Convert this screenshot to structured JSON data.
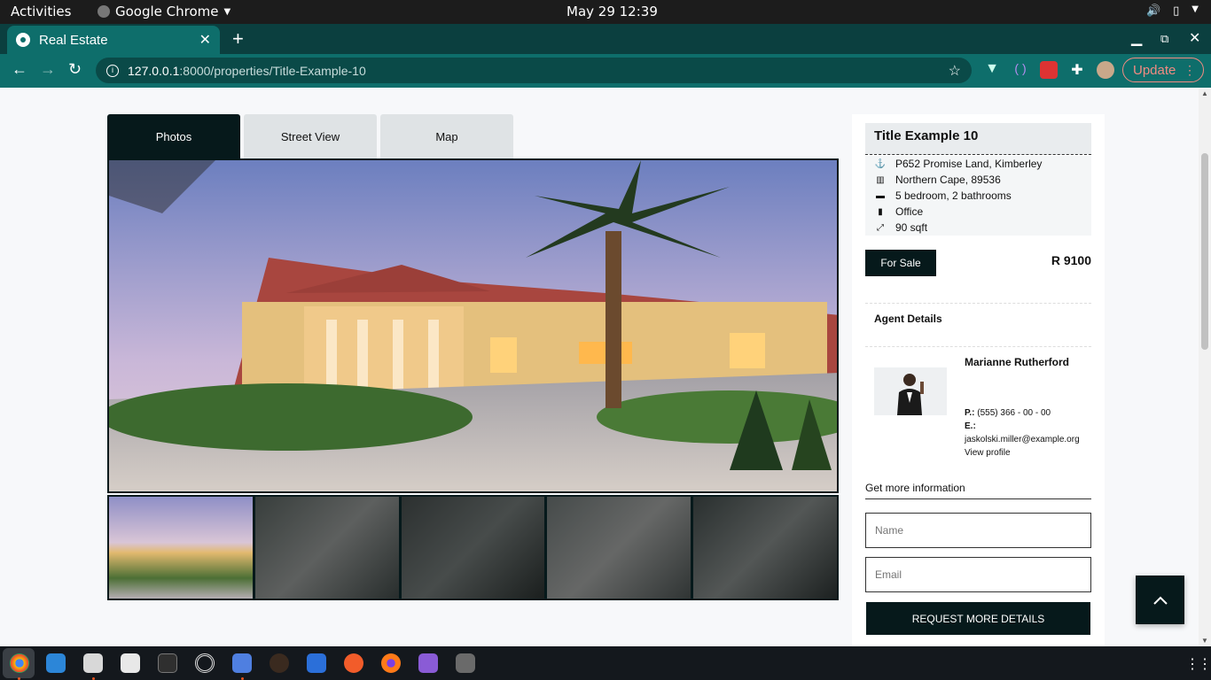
{
  "os": {
    "activities": "Activities",
    "app_name": "Google Chrome",
    "clock": "May 29  12:39"
  },
  "browser": {
    "tab_title": "Real Estate",
    "url_host": "127.0.0.1",
    "url_path": ":8000/properties/Title-Example-10",
    "update_label": "Update"
  },
  "property": {
    "tabs": [
      "Photos",
      "Street View",
      "Map"
    ],
    "title": "Title Example 10",
    "details": [
      {
        "icon": "location-icon",
        "text": "P652 Promise Land, Kimberley"
      },
      {
        "icon": "map-icon",
        "text": "Northern Cape, 89536"
      },
      {
        "icon": "bed-icon",
        "text": "5 bedroom, 2 bathrooms"
      },
      {
        "icon": "bookmark-icon",
        "text": "Office"
      },
      {
        "icon": "expand-icon",
        "text": "90 sqft"
      }
    ],
    "status_label": "For Sale",
    "price": "R 9100"
  },
  "agent": {
    "heading": "Agent Details",
    "name": "Marianne Rutherford",
    "phone_label": "P.:",
    "phone": "(555) 366 - 00 - 00",
    "email_label": "E.:",
    "email": "jaskolski.miller@example.org",
    "profile_link": "View profile"
  },
  "contact_form": {
    "heading": "Get more information",
    "name_placeholder": "Name",
    "email_placeholder": "Email",
    "submit_label": "REQUEST MORE DETAILS"
  },
  "colors": {
    "brand_dark": "#06191b",
    "browser_teal": "#0e6e6b"
  }
}
